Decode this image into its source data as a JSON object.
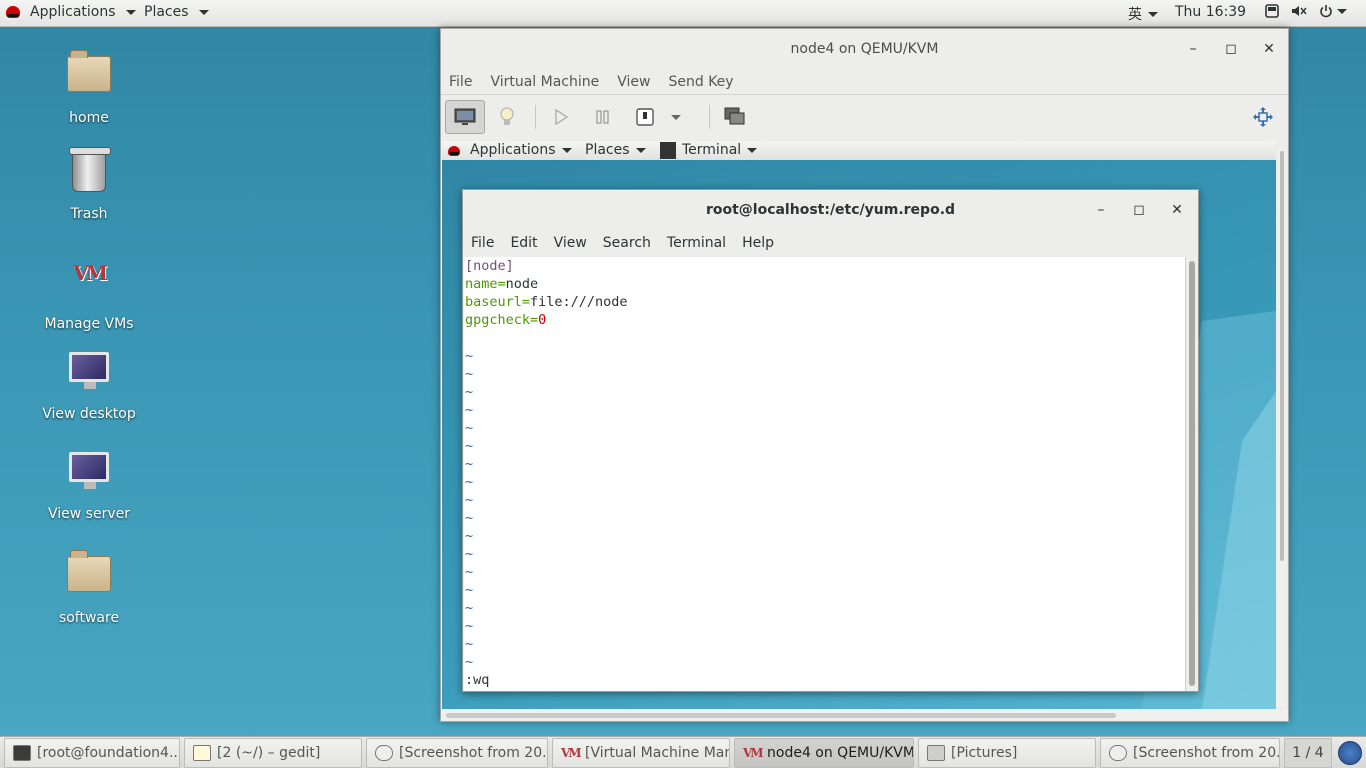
{
  "topbar": {
    "applications": "Applications",
    "places": "Places",
    "input_method": "英",
    "clock": "Thu 16:39"
  },
  "desktop": {
    "icons": [
      {
        "label": "home"
      },
      {
        "label": "Trash"
      },
      {
        "label": "Manage VMs"
      },
      {
        "label": "View desktop"
      },
      {
        "label": "View server"
      },
      {
        "label": "software"
      }
    ]
  },
  "vm_window": {
    "title": "node4 on QEMU/KVM",
    "controls": {
      "minimize": "–",
      "maximize": "◻",
      "close": "✕"
    },
    "menu": [
      "File",
      "Virtual Machine",
      "View",
      "Send Key"
    ],
    "guest_panel": {
      "applications": "Applications",
      "places": "Places",
      "terminal": "Terminal"
    }
  },
  "terminal": {
    "title": "root@localhost:/etc/yum.repo.d",
    "menu": [
      "File",
      "Edit",
      "View",
      "Search",
      "Terminal",
      "Help"
    ],
    "lines": {
      "l1": "[node]",
      "l2_key": "name=",
      "l2_val": "node",
      "l3_key": "baseurl=",
      "l3_val": "file:///node",
      "l4_key": "gpgcheck=",
      "l4_val": "0"
    },
    "tilde": "~",
    "command": ":wq"
  },
  "taskbar": {
    "items": [
      "[root@foundation4...",
      "[2 (~/) – gedit]",
      "[Screenshot from 20...",
      "[Virtual Machine Man...",
      "node4 on QEMU/KVM",
      "[Pictures]",
      "[Screenshot from 20..."
    ],
    "workspace": "1 / 4"
  },
  "colors": {
    "desktop_bg": "#3a97b5",
    "vim_section": "#75507b",
    "vim_key": "#4e9a06",
    "vim_number": "#cc0000",
    "vim_tilde": "#3465a4"
  }
}
